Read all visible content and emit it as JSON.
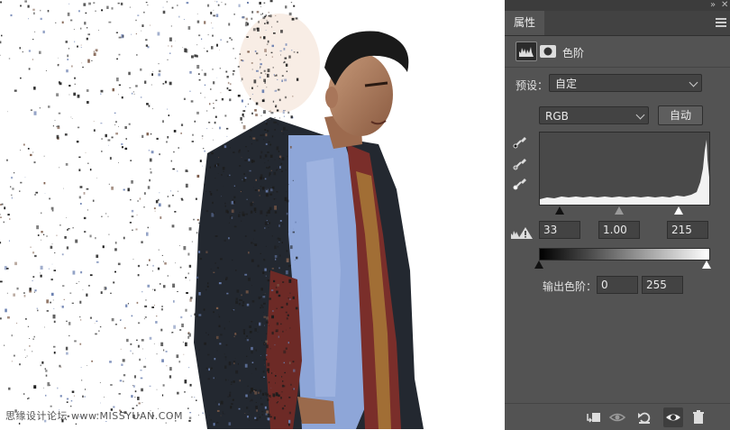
{
  "watermark": "思缘设计论坛 www.MISSYUAN.COM",
  "panel": {
    "tab_label": "属性",
    "header_title": "色阶",
    "preset_label": "预设：",
    "preset_value": "自定",
    "channel_value": "RGB",
    "auto_button": "自动",
    "input_black": "33",
    "input_gamma": "1.00",
    "input_white": "215",
    "output_label": "输出色阶：",
    "output_black": "0",
    "output_white": "255"
  },
  "icons": {
    "header": [
      "levels-adjustment-icon",
      "mask-icon"
    ],
    "droppers": [
      "black-point-eyedropper-icon",
      "gray-point-eyedropper-icon",
      "white-point-eyedropper-icon"
    ],
    "warning": "histogram-warning-icon",
    "bottom": [
      "clip-to-layer-icon",
      "view-previous-state-icon",
      "reset-icon",
      "visibility-eye-icon",
      "delete-icon"
    ]
  },
  "colors": {
    "panel_bg": "#535353",
    "field_bg": "#434343",
    "tab_bar_bg": "#424242"
  }
}
